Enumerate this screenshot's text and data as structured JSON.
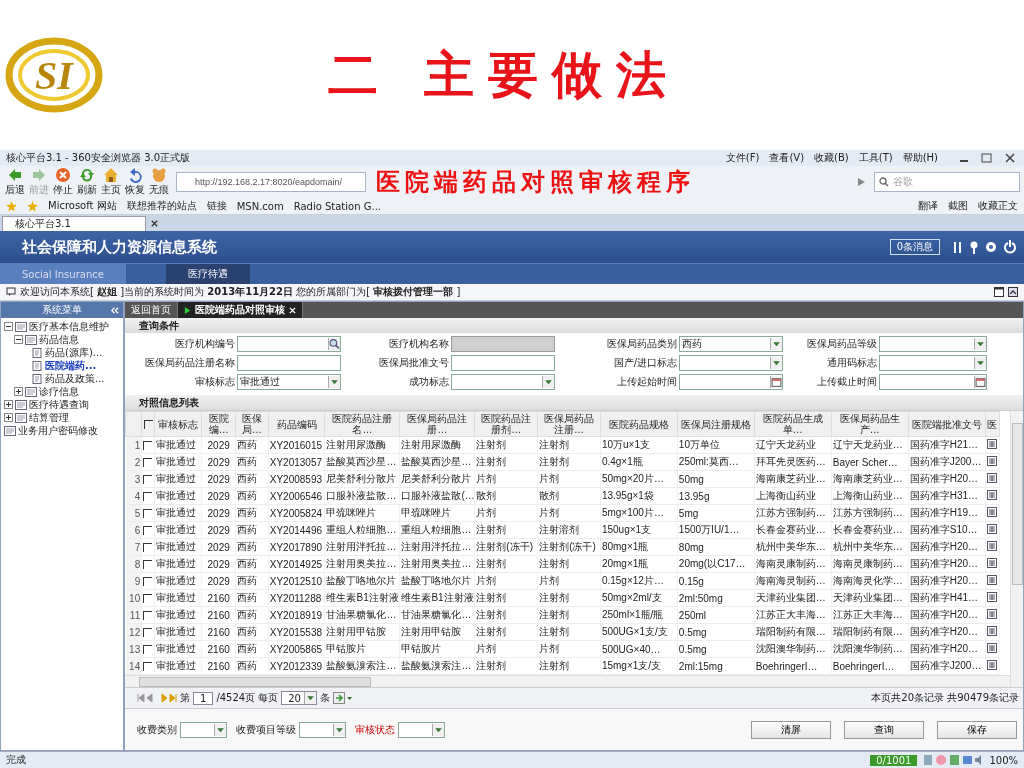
{
  "slide": {
    "logo": "SI",
    "title": "二 主要做法",
    "subtitle": "医院端药品对照审核程序"
  },
  "browser": {
    "title": "核心平台3.1 - 360安全浏览器 3.0正式版",
    "menu": [
      "文件(F)",
      "查看(V)",
      "收藏(B)",
      "工具(T)",
      "帮助(H)"
    ],
    "nav_buttons": [
      {
        "kind": "back",
        "label": "后退",
        "disabled": false
      },
      {
        "kind": "forward",
        "label": "前进",
        "disabled": true
      },
      {
        "kind": "stop",
        "label": "停止",
        "disabled": false
      },
      {
        "kind": "refresh",
        "label": "刷新",
        "disabled": false
      },
      {
        "kind": "home",
        "label": "主页",
        "disabled": false
      },
      {
        "kind": "restore",
        "label": "恢复",
        "disabled": false
      },
      {
        "kind": "incognito",
        "label": "无痕",
        "disabled": false
      }
    ],
    "url": "http://192.168.2.17:8020/eapdomain/",
    "search_placeholder": "谷歌",
    "favorites": [
      "Microsoft 网站",
      "联想推荐的站点",
      "链接",
      "MSN.com",
      "Radio Station G..."
    ],
    "right_tools": [
      "翻译",
      "截图",
      "收藏正文"
    ],
    "tab": "核心平台3.1"
  },
  "app": {
    "title": "社会保障和人力资源信息系统",
    "messages": "0条消息",
    "nav": [
      {
        "label": "Social Insurance",
        "selected": false
      },
      {
        "label": "医疗待遇",
        "selected": true
      }
    ],
    "welcome": "欢迎访问本系统[ **赵姐** ]当前的系统时间为 **2013年11月22日** 您的所属部门为[ **审核拨付管理一部** ]"
  },
  "sidebar": {
    "title": "系统菜单",
    "tree": [
      {
        "label": "医疗基本信息维护",
        "expanded": true,
        "selected": false,
        "children": [
          {
            "label": "药品信息",
            "expanded": true,
            "selected": false,
            "children": [
              {
                "label": "药品(源库)...",
                "selected": false
              },
              {
                "label": "医院端药...",
                "selected": true
              },
              {
                "label": "药品及政策...",
                "selected": false
              }
            ]
          },
          {
            "label": "诊疗信息",
            "expanded": false,
            "selected": false
          }
        ]
      },
      {
        "label": "医疗待遇查询",
        "expanded": false,
        "selected": false
      },
      {
        "label": "结算管理",
        "expanded": false,
        "selected": false
      },
      {
        "label": "业务用户密码修改",
        "selected": false
      }
    ]
  },
  "page_tabs": [
    {
      "label": "返回首页",
      "selected": false
    },
    {
      "label": "医院端药品对照审核",
      "selected": true
    }
  ],
  "query": {
    "title": "查询条件",
    "fields": [
      {
        "label": "医疗机构编号",
        "kind": "lookup",
        "disabled": false
      },
      {
        "label": "医疗机构名称",
        "kind": "text",
        "disabled": true
      },
      {
        "label": "医保局药品类别",
        "kind": "select",
        "value": "西药",
        "disabled": false
      },
      {
        "label": "医保局药品等级",
        "kind": "select",
        "disabled": false
      },
      {
        "label": "医保局药品注册名称",
        "kind": "text",
        "disabled": false
      },
      {
        "label": "医保局批准文号",
        "kind": "text",
        "disabled": false
      },
      {
        "label": "国产/进口标志",
        "kind": "select",
        "disabled": false
      },
      {
        "label": "通用码标志",
        "kind": "select",
        "disabled": false
      },
      {
        "label": "审核标志",
        "kind": "select",
        "value": "审批通过",
        "disabled": false
      },
      {
        "label": "成功标志",
        "kind": "select",
        "disabled": false
      },
      {
        "label": "上传起始时间",
        "kind": "date",
        "disabled": false
      },
      {
        "label": "上传截止时间",
        "kind": "date",
        "disabled": false
      }
    ]
  },
  "list": {
    "title": "对照信息列表",
    "select_all_checked": false,
    "columns": [
      "审核标志",
      "医院编…",
      "医保局…",
      "药品编码",
      "医院药品注册名…",
      "医保局药品注册…",
      "医院药品注册剂…",
      "医保局药品注册…",
      "医院药品规格",
      "医保局注册规格",
      "医院药品生成单…",
      "医保局药品生产…",
      "医院端批准文号",
      "医"
    ],
    "rows": [
      {
        "no": "1",
        "checked": false,
        "cells": [
          "审批通过",
          "2029",
          "西药",
          "XY2016015",
          "注射用尿激酶",
          "注射用尿激酶",
          "注射剂",
          "注射剂",
          "10万u×1支",
          "10万单位",
          "辽宁天龙药业",
          "辽宁天龙药业…",
          "国药准字H21…"
        ]
      },
      {
        "no": "2",
        "checked": false,
        "cells": [
          "审批通过",
          "2029",
          "西药",
          "XY2013057",
          "盐酸莫西沙星…",
          "盐酸莫西沙星…",
          "注射剂",
          "注射剂",
          "0.4g×1瓶",
          "250ml:莫西…",
          "拜耳先灵医药…",
          "Bayer Scher…",
          "国药准字J200…"
        ]
      },
      {
        "no": "3",
        "checked": false,
        "cells": [
          "审批通过",
          "2029",
          "西药",
          "XY2008593",
          "尼美舒利分散片",
          "尼美舒利分散片",
          "片剂",
          "片剂",
          "50mg×20片…",
          "50mg",
          "海南康芝药业…",
          "海南康芝药业…",
          "国药准字H20…"
        ]
      },
      {
        "no": "4",
        "checked": false,
        "cells": [
          "审批通过",
          "2029",
          "西药",
          "XY2006546",
          "口服补液盐散…",
          "口服补液盐散(…",
          "散剂",
          "散剂",
          "13.95g×1袋",
          "13.95g",
          "上海衡山药业",
          "上海衡山药业…",
          "国药准字H31…"
        ]
      },
      {
        "no": "5",
        "checked": false,
        "cells": [
          "审批通过",
          "2029",
          "西药",
          "XY2005824",
          "甲巯咪唑片",
          "甲巯咪唑片",
          "片剂",
          "片剂",
          "5mg×100片…",
          "5mg",
          "江苏方强制药…",
          "江苏方强制药…",
          "国药准字H19…"
        ]
      },
      {
        "no": "6",
        "checked": false,
        "cells": [
          "审批通过",
          "2029",
          "西药",
          "XY2014496",
          "重组人粒细胞…",
          "重组人粒细胞…",
          "注射剂",
          "注射溶剂",
          "150ug×1支",
          "1500万IU/1…",
          "长春金赛药业…",
          "长春金赛药业…",
          "国药准字S10…"
        ]
      },
      {
        "no": "7",
        "checked": false,
        "cells": [
          "审批通过",
          "2029",
          "西药",
          "XY2017890",
          "注射用泮托拉…",
          "注射用泮托拉…",
          "注射剂(冻干)",
          "注射剂(冻干)",
          "80mg×1瓶",
          "80mg",
          "杭州中美华东…",
          "杭州中美华东…",
          "国药准字H20…"
        ]
      },
      {
        "no": "8",
        "checked": false,
        "cells": [
          "审批通过",
          "2029",
          "西药",
          "XY2014925",
          "注射用奥美拉…",
          "注射用奥美拉…",
          "注射剂",
          "注射剂",
          "20mg×1瓶",
          "20mg(以C17…",
          "海南灵康制药…",
          "海南灵康制药…",
          "国药准字H20…"
        ]
      },
      {
        "no": "9",
        "checked": false,
        "cells": [
          "审批通过",
          "2029",
          "西药",
          "XY2012510",
          "盐酸丁咯地尔片",
          "盐酸丁咯地尔片",
          "片剂",
          "片剂",
          "0.15g×12片…",
          "0.15g",
          "海南海灵制药…",
          "海南海灵化学…",
          "国药准字H20…"
        ]
      },
      {
        "no": "10",
        "checked": false,
        "cells": [
          "审批通过",
          "2160",
          "西药",
          "XY2011288",
          "维生素B1注射液",
          "维生素B1注射液",
          "注射剂",
          "注射剂",
          "50mg×2ml/支",
          "2ml:50mg",
          "天津药业集团…",
          "天津药业集团…",
          "国药准字H41…"
        ]
      },
      {
        "no": "11",
        "checked": false,
        "cells": [
          "审批通过",
          "2160",
          "西药",
          "XY2018919",
          "甘油果糖氯化…",
          "甘油果糖氯化…",
          "注射剂",
          "注射剂",
          "250ml×1瓶/瓶",
          "250ml",
          "江苏正大丰海…",
          "江苏正大丰海…",
          "国药准字H20…"
        ]
      },
      {
        "no": "12",
        "checked": false,
        "cells": [
          "审批通过",
          "2160",
          "西药",
          "XY2015538",
          "注射用甲钴胺",
          "注射用甲钴胺",
          "注射剂",
          "注射剂",
          "500UG×1支/支",
          "0.5mg",
          "瑞阳制药有限…",
          "瑞阳制药有限…",
          "国药准字H20…"
        ]
      },
      {
        "no": "13",
        "checked": false,
        "cells": [
          "审批通过",
          "2160",
          "西药",
          "XY2005865",
          "甲钴胺片",
          "甲钴胺片",
          "片剂",
          "片剂",
          "500UG×40…",
          "0.5mg",
          "沈阳澳华制药…",
          "沈阳澳华制药…",
          "国药准字H20…"
        ]
      },
      {
        "no": "14",
        "checked": false,
        "cells": [
          "审批通过",
          "2160",
          "西药",
          "XY2012339",
          "盐酸氨溴索注…",
          "盐酸氨溴索注…",
          "注射剂",
          "注射剂",
          "15mg×1支/支",
          "2ml:15mg",
          "BoehringerI…",
          "BoehringerI…",
          "国药准字J200…"
        ]
      }
    ]
  },
  "pager": {
    "prefix": "第",
    "page": "1",
    "pages": "/4524页",
    "per_label": "每页",
    "per_page": "20",
    "unit": "条",
    "summary": "本页共20条记录 共90479条记录"
  },
  "bottom_filters": [
    {
      "label": "收费类别",
      "required": false
    },
    {
      "label": "收费项目等级",
      "required": false
    },
    {
      "label": "审核状态",
      "required": true
    }
  ],
  "buttons": [
    "清屏",
    "查询",
    "保存"
  ],
  "status_bar": {
    "text": "完成",
    "counter": "0/1001",
    "zoom": "100%"
  }
}
